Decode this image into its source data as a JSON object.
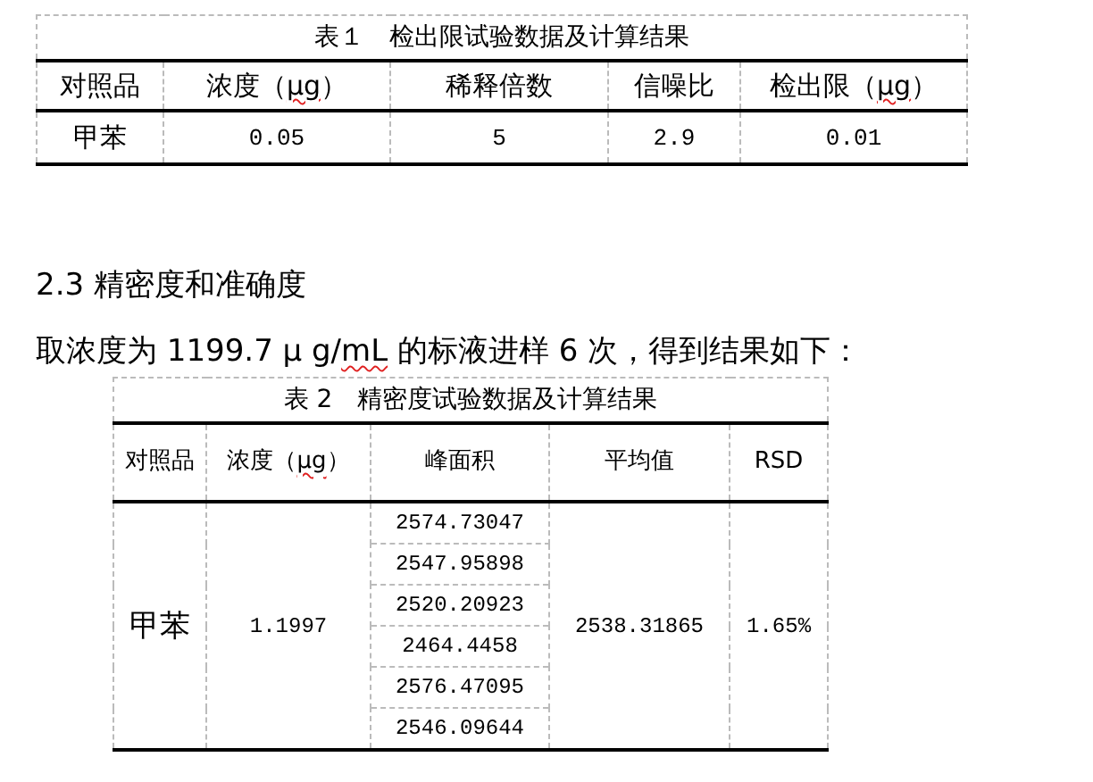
{
  "table_1": {
    "title": "表１　检出限试验数据及计算结果",
    "columns": [
      {
        "parts": [
          {
            "text": "对照品",
            "flagged": false
          }
        ]
      },
      {
        "parts": [
          {
            "text": "浓度（",
            "flagged": false
          },
          {
            "text": "μg",
            "flagged": true
          },
          {
            "text": "）",
            "flagged": false
          }
        ]
      },
      {
        "parts": [
          {
            "text": "稀释倍数",
            "flagged": false
          }
        ]
      },
      {
        "parts": [
          {
            "text": "信噪比",
            "flagged": false
          }
        ]
      },
      {
        "parts": [
          {
            "text": "检出限（",
            "flagged": false
          },
          {
            "text": "μg",
            "flagged": true
          },
          {
            "text": "）",
            "flagged": false
          }
        ]
      }
    ],
    "rows": [
      [
        "甲苯",
        "0.05",
        "5",
        "2.9",
        "0.01"
      ]
    ]
  },
  "section_heading": "2.3 精密度和准确度",
  "paragraph": [
    {
      "text": "取浓度为 1199.7 μ g/",
      "flagged": false
    },
    {
      "text": "mL",
      "flagged": true
    },
    {
      "text": " 的标液进样 6 次，得到结果如下：",
      "flagged": false
    }
  ],
  "table_2": {
    "title": "表 2　精密度试验数据及计算结果",
    "columns": [
      {
        "parts": [
          {
            "text": "对照品",
            "flagged": false
          }
        ]
      },
      {
        "parts": [
          {
            "text": "浓度（",
            "flagged": false
          },
          {
            "text": "μg",
            "flagged": true
          },
          {
            "text": "）",
            "flagged": false
          }
        ]
      },
      {
        "parts": [
          {
            "text": "峰面积",
            "flagged": false
          }
        ]
      },
      {
        "parts": [
          {
            "text": "平均值",
            "flagged": false
          }
        ]
      },
      {
        "parts": [
          {
            "text": "RSD",
            "flagged": false
          }
        ]
      }
    ],
    "sample": "甲苯",
    "concentration": "1.1997",
    "peak_areas": [
      "2574.73047",
      "2547.95898",
      "2520.20923",
      "2464.4458",
      "2576.47095",
      "2546.09644"
    ],
    "mean": "2538.31865",
    "rsd": "1.65%"
  }
}
